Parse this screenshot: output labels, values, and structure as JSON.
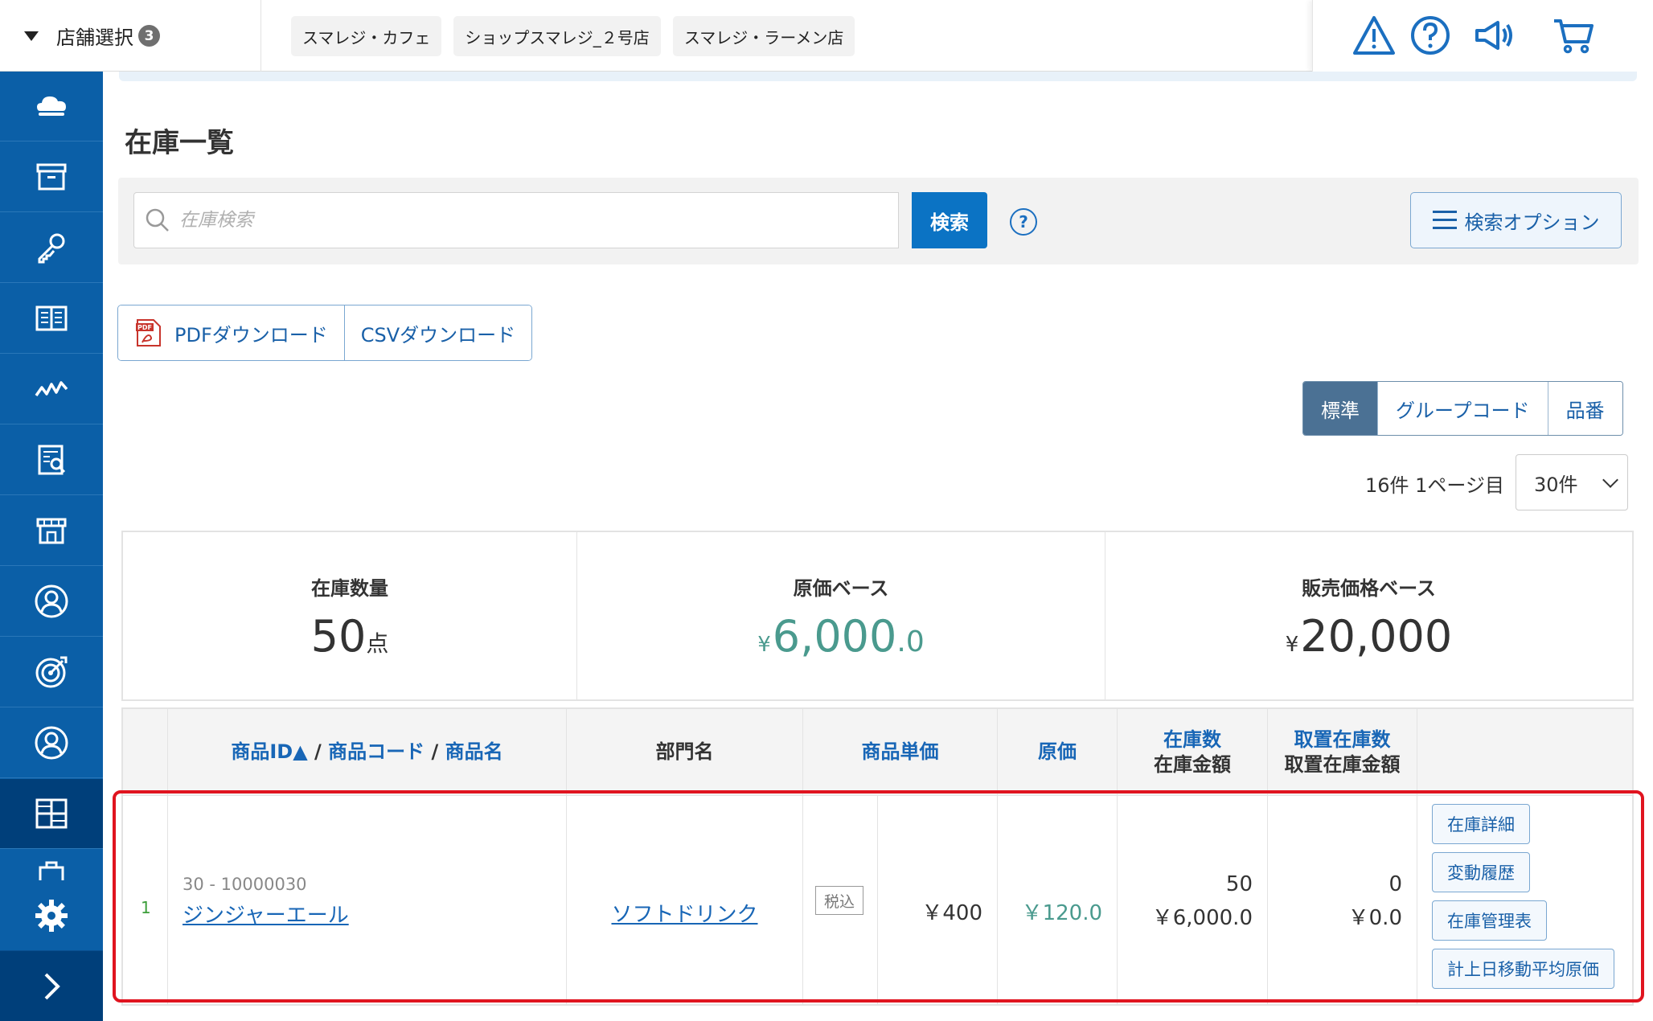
{
  "header": {
    "store_select_label": "店舗選択",
    "store_count": "3",
    "stores": [
      "スマレジ・カフェ",
      "ショップスマレジ_２号店",
      "スマレジ・ラーメン店"
    ],
    "icons": [
      "warning-icon",
      "help-icon",
      "announcement-icon",
      "cart-icon"
    ]
  },
  "sidebar": {
    "items": [
      "cloud-icon",
      "archive-icon",
      "key-icon",
      "book-icon",
      "analytics-icon",
      "report-icon",
      "store-icon",
      "customer-icon",
      "target-icon",
      "user-icon",
      "inventory-icon",
      "briefcase-icon"
    ],
    "active_item": "inventory-icon",
    "bottom": [
      "settings-icon",
      "expand-icon"
    ]
  },
  "page": {
    "title": "在庫一覧"
  },
  "search": {
    "placeholder": "在庫検索",
    "button": "検索",
    "help": "?",
    "options_button": "検索オプション"
  },
  "downloads": {
    "pdf": "PDFダウンロード",
    "csv": "CSVダウンロード"
  },
  "view_toggle": {
    "options": [
      "標準",
      "グループコード",
      "品番"
    ],
    "active": "標準"
  },
  "pagination": {
    "info": "16件 1ページ目",
    "per_page": "30件"
  },
  "summary": {
    "quantity": {
      "label": "在庫数量",
      "value": "50",
      "unit": "点"
    },
    "cost_base": {
      "label": "原価ベース",
      "yen": "¥",
      "value": "6,000",
      "decimal": ".0"
    },
    "sales_base": {
      "label": "販売価格ベース",
      "yen": "¥",
      "value": "20,000"
    }
  },
  "table": {
    "headers": {
      "product_id": "商品ID▲",
      "sep": "/",
      "product_code": "商品コード",
      "product_name": "商品名",
      "department": "部門名",
      "unit_price": "商品単価",
      "cost": "原価",
      "stock_qty": "在庫数",
      "stock_amount": "在庫金額",
      "reserved_qty": "取置在庫数",
      "reserved_amount": "取置在庫金額"
    },
    "rows": [
      {
        "no": "1",
        "code": "30 - 10000030",
        "name": "ジンジャーエール",
        "department": "ソフトドリンク",
        "tax": "税込",
        "price": "￥400",
        "cost": "￥120.0",
        "stock_qty": "50",
        "stock_amount": "￥6,000.0",
        "reserved_qty": "0",
        "reserved_amount": "￥0.0",
        "actions": [
          "在庫詳細",
          "変動履歴",
          "在庫管理表",
          "計上日移動平均原価"
        ]
      }
    ]
  },
  "colors": {
    "sidebar": "#0b5fa7",
    "accent": "#0b73c4",
    "teal": "#4a9a8e",
    "highlight": "#e0141f"
  }
}
